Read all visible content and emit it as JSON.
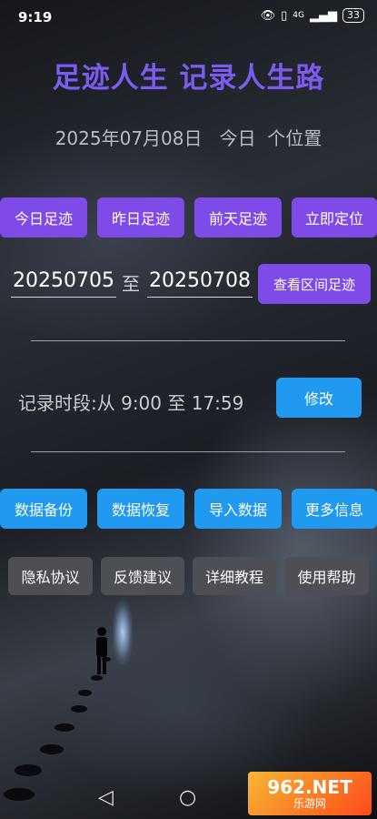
{
  "status_bar": {
    "time": "9:19",
    "signal": "4G",
    "battery": "33"
  },
  "header": {
    "title": "足迹人生  记录人生路",
    "subtitle": "2025年07月08日   今日  个位置"
  },
  "quick_buttons": [
    "今日足迹",
    "昨日足迹",
    "前天足迹",
    "立即定位"
  ],
  "range": {
    "start": "20250705",
    "separator": "至",
    "end": "20250708",
    "view_button": "查看区间足迹"
  },
  "record": {
    "label": "记录时段:从 9:00 至 17:59",
    "edit_button": "修改"
  },
  "data_buttons": [
    "数据备份",
    "数据恢复",
    "导入数据",
    "更多信息"
  ],
  "info_buttons": [
    "隐私协议",
    "反馈建议",
    "详细教程",
    "使用帮助"
  ],
  "watermark": {
    "main": "962.NET",
    "sub": "乐游网"
  },
  "colors": {
    "title": "#7c5cf0",
    "purple_button": "#7f4be8",
    "blue_button": "#1f9af0",
    "gray_button": "#4d4f55"
  }
}
